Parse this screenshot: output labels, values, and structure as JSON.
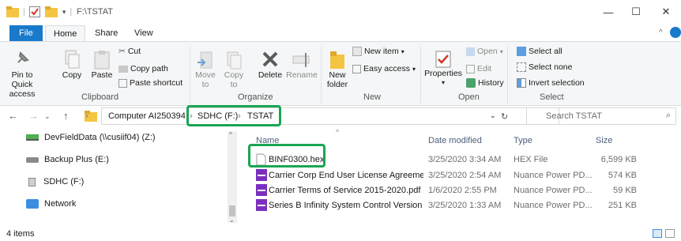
{
  "window": {
    "title": "F:\\TSTAT",
    "minimize": "—",
    "maximize": "☐",
    "close": "✕"
  },
  "ribbon_tabs": [
    "File",
    "Home",
    "Share",
    "View"
  ],
  "ribbon": {
    "clipboard": {
      "label": "Clipboard",
      "pin": "Pin to Quick access",
      "copy": "Copy",
      "paste": "Paste",
      "cut": "Cut",
      "copy_path": "Copy path",
      "paste_shortcut": "Paste shortcut"
    },
    "organize": {
      "label": "Organize",
      "move_to": "Move to",
      "copy_to": "Copy to",
      "delete": "Delete",
      "rename": "Rename"
    },
    "new": {
      "label": "New",
      "new_folder": "New folder",
      "new_item": "New item",
      "easy_access": "Easy access"
    },
    "open": {
      "label": "Open",
      "properties": "Properties",
      "open": "Open",
      "edit": "Edit",
      "history": "History"
    },
    "select": {
      "label": "Select",
      "select_all": "Select all",
      "select_none": "Select none",
      "invert": "Invert selection"
    }
  },
  "address": {
    "crumbs": [
      "Computer AI250394",
      "SDHC (F:)",
      "TSTAT"
    ],
    "search_placeholder": "Search TSTAT"
  },
  "nav": [
    {
      "label": "DevFieldData (\\\\cusiif04) (Z:)",
      "icon": "network-drive-icon"
    },
    {
      "label": "Backup Plus (E:)",
      "icon": "drive-icon"
    },
    {
      "label": "SDHC (F:)",
      "icon": "sd-card-icon"
    },
    {
      "label": "Network",
      "icon": "network-icon"
    }
  ],
  "columns": {
    "name": "Name",
    "date": "Date modified",
    "type": "Type",
    "size": "Size"
  },
  "files": [
    {
      "name": "BINF0300.hex",
      "date": "3/25/2020 3:34 AM",
      "type": "HEX File",
      "size": "6,599 KB",
      "icon": "file-icon"
    },
    {
      "name": "Carrier Corp End User License Agreeme...",
      "date": "3/25/2020 2:54 AM",
      "type": "Nuance Power PD...",
      "size": "574 KB",
      "icon": "pdf-icon"
    },
    {
      "name": "Carrier Terms of Service 2015-2020.pdf",
      "date": "1/6/2020 2:55 PM",
      "type": "Nuance Power PD...",
      "size": "59 KB",
      "icon": "pdf-icon"
    },
    {
      "name": "Series B Infinity System Control Version ...",
      "date": "3/25/2020 1:33 AM",
      "type": "Nuance Power PD...",
      "size": "251 KB",
      "icon": "pdf-icon"
    }
  ],
  "status": {
    "count": "4 items"
  },
  "colors": {
    "accent": "#1979ca",
    "highlight": "#1aa653",
    "folder": "#f4c542",
    "pdf": "#7b2fbf"
  }
}
